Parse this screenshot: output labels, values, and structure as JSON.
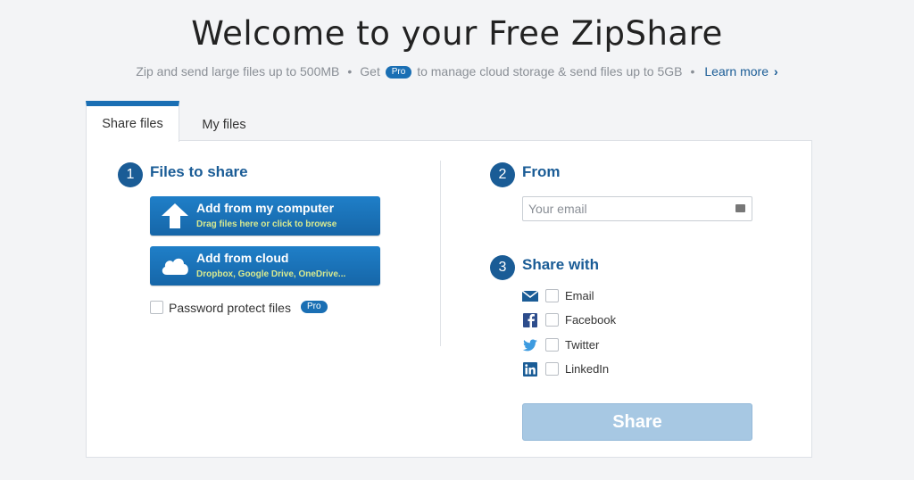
{
  "header": {
    "title": "Welcome to your Free ZipShare",
    "subtitle_part1": "Zip and send large files up to 500MB",
    "separator": "•",
    "subtitle_get": "Get",
    "pro_badge": "Pro",
    "subtitle_part2": "to manage cloud storage & send files up to 5GB",
    "learn_more": "Learn more",
    "learn_more_chevron": "›"
  },
  "tabs": [
    {
      "label": "Share files",
      "active": true
    },
    {
      "label": "My files",
      "active": false
    }
  ],
  "step1": {
    "number": "1",
    "title": "Files to share",
    "computer_button": {
      "main": "Add from my computer",
      "sub": "Drag files here or click to browse",
      "icon": "upload-arrow-icon"
    },
    "cloud_button": {
      "main": "Add from cloud",
      "sub": "Dropbox, Google Drive, OneDrive...",
      "icon": "cloud-icon"
    },
    "password_label": "Password protect files",
    "password_checked": false,
    "pro_badge": "Pro"
  },
  "step2": {
    "number": "2",
    "title": "From",
    "email_placeholder": "Your email",
    "email_value": ""
  },
  "step3": {
    "number": "3",
    "title": "Share with",
    "options": [
      {
        "label": "Email",
        "icon": "envelope-icon",
        "checked": false
      },
      {
        "label": "Facebook",
        "icon": "facebook-icon",
        "checked": false
      },
      {
        "label": "Twitter",
        "icon": "twitter-icon",
        "checked": false
      },
      {
        "label": "LinkedIn",
        "icon": "linkedin-icon",
        "checked": false
      }
    ]
  },
  "share_button": "Share",
  "colors": {
    "accent": "#1a5c96",
    "button_blue": "#1a6fb4",
    "share_disabled": "#a7c8e3",
    "sub_text_yellow": "#d9ea8f",
    "background": "#f3f4f6"
  }
}
